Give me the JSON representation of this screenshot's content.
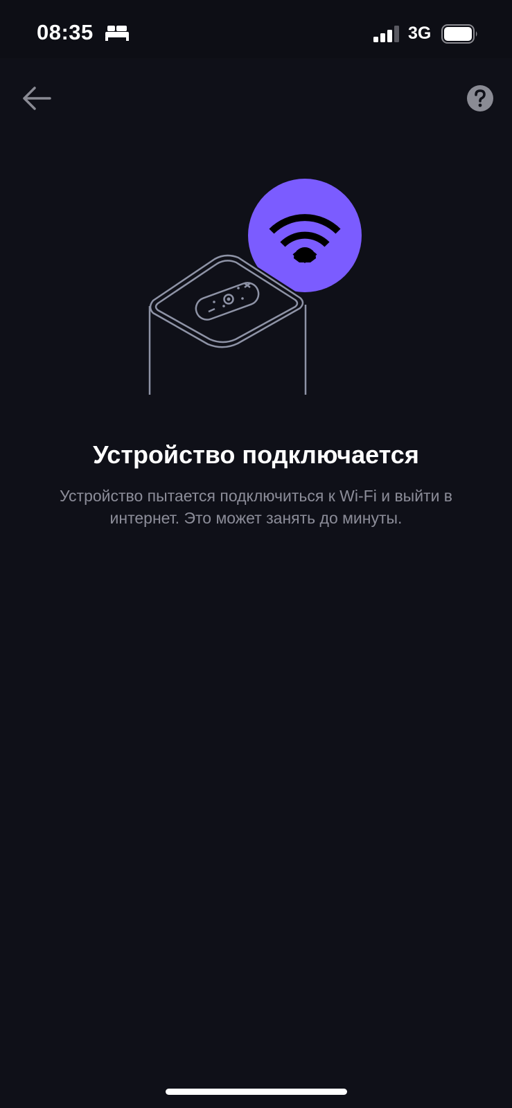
{
  "status_bar": {
    "time": "08:35",
    "sleep_icon": "bed-icon",
    "signal_icon": "cellular-signal-icon",
    "network": "3G",
    "battery_icon": "battery-icon"
  },
  "nav": {
    "back_icon": "arrow-left-icon",
    "help_icon": "question-circle-icon"
  },
  "illustration": {
    "device": "smart-speaker-illustration",
    "badge_icon": "wifi-icon",
    "badge_color": "#7b5cff"
  },
  "content": {
    "title": "Устройство подключается",
    "description": "Устройство пытается подключиться к Wi-Fi и выйти в интернет. Это может занять до минуты."
  },
  "colors": {
    "background": "#0f1018",
    "accent": "#7b5cff",
    "secondary_text": "#8c8d99"
  }
}
